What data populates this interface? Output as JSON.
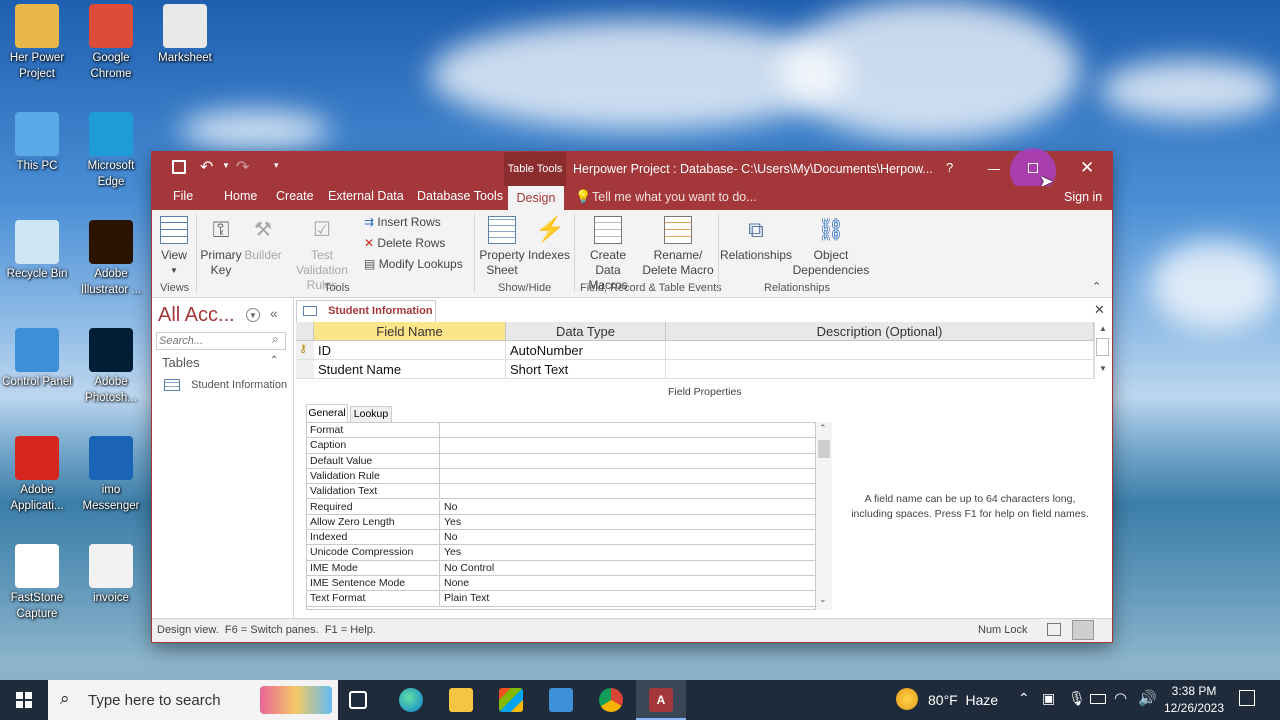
{
  "desktop": {
    "icons": [
      {
        "label": "Her Power Project",
        "icon": "folder-person-icon",
        "color": "#e8b84a"
      },
      {
        "label": "Google Chrome",
        "icon": "chrome-icon",
        "color": "#dd4b39"
      },
      {
        "label": "Marksheet",
        "icon": "document-icon",
        "color": "#e9e9e9"
      },
      {
        "label": "This PC",
        "icon": "computer-icon",
        "color": "#5aa9e6"
      },
      {
        "label": "Microsoft Edge",
        "icon": "edge-icon",
        "color": "#1f9bd8"
      },
      {
        "label": "Recycle Bin",
        "icon": "recycle-bin-icon",
        "color": "#cfe6f5"
      },
      {
        "label": "Adobe Illustrator ...",
        "icon": "illustrator-icon",
        "color": "#2a1400"
      },
      {
        "label": "Control Panel",
        "icon": "control-panel-icon",
        "color": "#3d8fd6"
      },
      {
        "label": "Adobe Photosh...",
        "icon": "photoshop-icon",
        "color": "#001e36"
      },
      {
        "label": "Adobe Applicati...",
        "icon": "adobe-icon",
        "color": "#d7261e"
      },
      {
        "label": "imo Messenger",
        "icon": "imo-icon",
        "color": "#1a63b5"
      },
      {
        "label": "FastStone Capture",
        "icon": "faststone-icon",
        "color": "#ffffff"
      },
      {
        "label": "invoice",
        "icon": "document-icon",
        "color": "#f2f2f2"
      }
    ]
  },
  "window": {
    "title": "Herpower Project : Database- C:\\Users\\My\\Documents\\Herpow...",
    "context_tab": "Table Tools",
    "help": "?",
    "tabs": [
      "File",
      "Home",
      "Create",
      "External Data",
      "Database Tools",
      "Design"
    ],
    "active_tab": "Design",
    "tell_me": "Tell me what you want to do...",
    "sign_in": "Sign in",
    "accent": "#a4373a"
  },
  "ribbon": {
    "view": "View",
    "primary_key": "Primary Key",
    "builder": "Builder",
    "test_validation_rules": "Test Validation Rules",
    "insert_rows": "Insert Rows",
    "delete_rows": "Delete Rows",
    "modify_lookups": "Modify Lookups",
    "property_sheet": "Property Sheet",
    "indexes": "Indexes",
    "create_data_macros": "Create Data Macros",
    "rename_delete_macro": "Rename/ Delete Macro",
    "relationships": "Relationships",
    "object_dependencies": "Object Dependencies",
    "groups": {
      "views": "Views",
      "tools": "Tools",
      "show_hide": "Show/Hide",
      "field_record": "Field, Record & Table Events",
      "relationships": "Relationships"
    }
  },
  "nav_pane": {
    "title": "All Acc...",
    "search_placeholder": "Search...",
    "section": "Tables",
    "items": [
      "Student Information"
    ]
  },
  "document": {
    "tab": "Student Information",
    "columns": [
      "Field Name",
      "Data Type",
      "Description (Optional)"
    ],
    "rows": [
      {
        "field": "ID",
        "type": "AutoNumber",
        "description": ""
      },
      {
        "field": "Student Name",
        "type": "Short Text",
        "description": ""
      }
    ],
    "field_properties_label": "Field Properties",
    "prop_tabs": [
      "General",
      "Lookup"
    ],
    "properties": [
      {
        "name": "Format",
        "value": ""
      },
      {
        "name": "Caption",
        "value": ""
      },
      {
        "name": "Default Value",
        "value": ""
      },
      {
        "name": "Validation Rule",
        "value": ""
      },
      {
        "name": "Validation Text",
        "value": ""
      },
      {
        "name": "Required",
        "value": "No"
      },
      {
        "name": "Allow Zero Length",
        "value": "Yes"
      },
      {
        "name": "Indexed",
        "value": "No"
      },
      {
        "name": "Unicode Compression",
        "value": "Yes"
      },
      {
        "name": "IME Mode",
        "value": "No Control"
      },
      {
        "name": "IME Sentence Mode",
        "value": "None"
      },
      {
        "name": "Text Format",
        "value": "Plain Text"
      }
    ],
    "help_text": "A field name can be up to 64 characters long, including spaces. Press F1 for help on field names."
  },
  "status": {
    "left": "Design view.  F6 = Switch panes.  F1 = Help.",
    "num_lock": "Num Lock"
  },
  "taskbar": {
    "search_placeholder": "Type here to search",
    "weather": "80°F  Haze",
    "time": "3:38 PM",
    "date": "12/26/2023"
  }
}
